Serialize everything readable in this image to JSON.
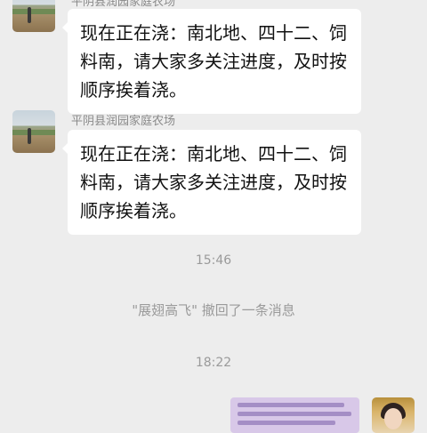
{
  "messages": [
    {
      "sender": "平阴县润园家庭农场",
      "text": "现在正在浇：南北地、四十二、饲料南，请大家多关注进度，及时按顺序挨着浇。"
    },
    {
      "sender": "平阴县润园家庭农场",
      "text": "现在正在浇：南北地、四十二、饲料南，请大家多关注进度，及时按顺序挨着浇。"
    }
  ],
  "system": {
    "time1": "15:46",
    "recall_notice": "\"展翅高飞\" 撤回了一条消息",
    "time2": "18:22"
  },
  "colors": {
    "background": "#ededed",
    "bubble": "#ffffff",
    "meta_text": "#9a9a9a"
  },
  "icons": [
    "farm-landscape-avatar",
    "user-portrait-avatar"
  ]
}
